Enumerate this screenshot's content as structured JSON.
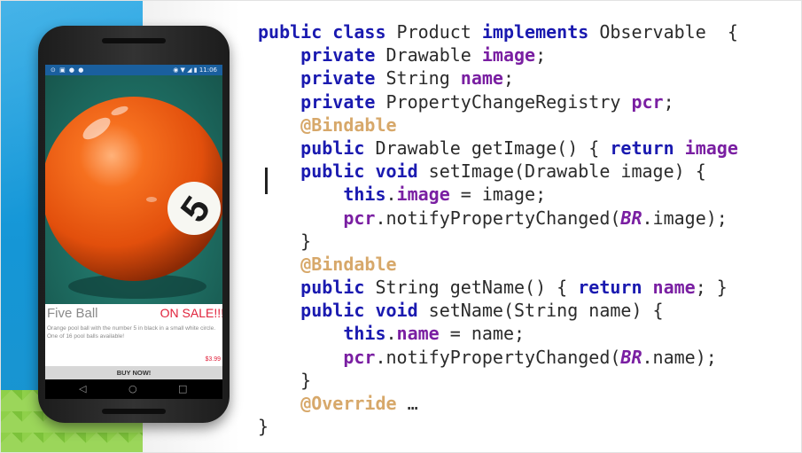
{
  "phone": {
    "statusbar_left": "⊙ ▣ ● ●",
    "statusbar_right": "◉ ▼ ◢ ▮ 11:06",
    "ball_number": "5",
    "product_title": "Five Ball",
    "sale_badge": "ON SALE!!!",
    "product_description": "Orange pool ball with the number 5 in black in a small white circle. One of 16 pool balls available!",
    "price": "$3.99",
    "buy_button": "BUY NOW!",
    "nav_back": "◁",
    "nav_home": "○",
    "nav_recent": "□"
  },
  "code": {
    "lines": [
      [
        [
          "kw",
          "public class "
        ],
        [
          "t",
          "Product "
        ],
        [
          "kw",
          "implements "
        ],
        [
          "t",
          "Observable  {"
        ]
      ],
      [
        [
          "t",
          "    "
        ],
        [
          "kw",
          "private "
        ],
        [
          "t",
          "Drawable "
        ],
        [
          "fld",
          "image"
        ],
        [
          "t",
          ";"
        ]
      ],
      [
        [
          "t",
          "    "
        ],
        [
          "kw",
          "private "
        ],
        [
          "t",
          "String "
        ],
        [
          "fld",
          "name"
        ],
        [
          "t",
          ";"
        ]
      ],
      [
        [
          "t",
          "    "
        ],
        [
          "kw",
          "private "
        ],
        [
          "t",
          "PropertyChangeRegistry "
        ],
        [
          "fld",
          "pcr"
        ],
        [
          "t",
          ";"
        ]
      ],
      [
        [
          "t",
          "    "
        ],
        [
          "ann",
          "@Bindable"
        ]
      ],
      [
        [
          "t",
          "    "
        ],
        [
          "kw",
          "public "
        ],
        [
          "t",
          "Drawable getImage() { "
        ],
        [
          "kw",
          "return "
        ],
        [
          "fld",
          "image"
        ]
      ],
      [
        [
          "t",
          "    "
        ],
        [
          "kw",
          "public void "
        ],
        [
          "t",
          "setImage(Drawable image) {"
        ]
      ],
      [
        [
          "t",
          "        "
        ],
        [
          "kw",
          "this"
        ],
        [
          "t",
          "."
        ],
        [
          "fld",
          "image"
        ],
        [
          "t",
          " = image;"
        ]
      ],
      [
        [
          "t",
          "        "
        ],
        [
          "fld",
          "pcr"
        ],
        [
          "t",
          ".notifyPropertyChanged("
        ],
        [
          "cls",
          "BR"
        ],
        [
          "t",
          ".image);"
        ]
      ],
      [
        [
          "t",
          "    }"
        ]
      ],
      [
        [
          "t",
          "    "
        ],
        [
          "ann",
          "@Bindable"
        ]
      ],
      [
        [
          "t",
          "    "
        ],
        [
          "kw",
          "public "
        ],
        [
          "t",
          "String getName() { "
        ],
        [
          "kw",
          "return "
        ],
        [
          "fld",
          "name"
        ],
        [
          "t",
          "; }"
        ]
      ],
      [
        [
          "t",
          "    "
        ],
        [
          "kw",
          "public void "
        ],
        [
          "t",
          "setName(String name) {"
        ]
      ],
      [
        [
          "t",
          "        "
        ],
        [
          "kw",
          "this"
        ],
        [
          "t",
          "."
        ],
        [
          "fld",
          "name"
        ],
        [
          "t",
          " = name;"
        ]
      ],
      [
        [
          "t",
          "        "
        ],
        [
          "fld",
          "pcr"
        ],
        [
          "t",
          ".notifyPropertyChanged("
        ],
        [
          "cls",
          "BR"
        ],
        [
          "t",
          ".name);"
        ]
      ],
      [
        [
          "t",
          "    }"
        ]
      ],
      [
        [
          "t",
          "    "
        ],
        [
          "ann",
          "@Override"
        ],
        [
          "t",
          " …"
        ]
      ],
      [
        [
          "t",
          "}"
        ]
      ]
    ]
  },
  "colors": {
    "keyword": "#1a1ab0",
    "field": "#7a1fa2",
    "annotation": "#d7a86a",
    "sale_red": "#e0223b",
    "ball_orange": "#f25a12"
  }
}
